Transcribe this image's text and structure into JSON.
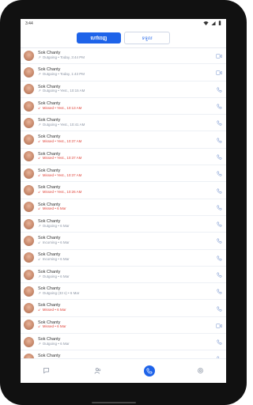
{
  "status": {
    "time": "3:44"
  },
  "tabs": [
    {
      "label": "ហៅចេញ",
      "active": true
    },
    {
      "label": "ទទួល",
      "active": false
    }
  ],
  "calls": [
    {
      "name": "Sok Chanty",
      "detail": "Outgoing • Today, 3:44 PM",
      "type": "outgoing",
      "icon": "video-icon"
    },
    {
      "name": "Sok Chanty",
      "detail": "Outgoing • Today, 1:43 PM",
      "type": "outgoing",
      "icon": "video-icon"
    },
    {
      "name": "Sok Chanty",
      "detail": "Outgoing • Yest., 10:15 AM",
      "type": "outgoing",
      "icon": "phone-icon"
    },
    {
      "name": "Sok Chanty",
      "detail": "Missed • Yest., 10:13 AM",
      "type": "missed",
      "icon": "phone-icon"
    },
    {
      "name": "Sok Chanty",
      "detail": "Outgoing • Yest., 10:41 AM",
      "type": "outgoing",
      "icon": "phone-icon"
    },
    {
      "name": "Sok Chanty",
      "detail": "Missed • Yest., 10:37 AM",
      "type": "missed",
      "icon": "phone-icon"
    },
    {
      "name": "Sok Chanty",
      "detail": "Missed • Yest., 10:37 AM",
      "type": "missed",
      "icon": "phone-icon"
    },
    {
      "name": "Sok Chanty",
      "detail": "Missed • Yest., 10:37 AM",
      "type": "missed",
      "icon": "phone-icon"
    },
    {
      "name": "Sok Chanty",
      "detail": "Missed • Yest., 10:26 AM",
      "type": "missed",
      "icon": "phone-icon"
    },
    {
      "name": "Sok Chanty",
      "detail": "Missed • 6 Mar",
      "type": "missed",
      "icon": "phone-icon"
    },
    {
      "name": "Sok Chanty",
      "detail": "Outgoing • 6 Mar",
      "type": "outgoing",
      "icon": "phone-icon"
    },
    {
      "name": "Sok Chanty",
      "detail": "Incoming • 6 Mar",
      "type": "incoming",
      "icon": "phone-icon"
    },
    {
      "name": "Sok Chanty",
      "detail": "Incoming • 6 Mar",
      "type": "incoming",
      "icon": "phone-icon"
    },
    {
      "name": "Sok Chanty",
      "detail": "Outgoing • 6 Mar",
      "type": "outgoing",
      "icon": "phone-icon"
    },
    {
      "name": "Sok Chanty",
      "detail": "Outgoing (33 s) • 6 Mar",
      "type": "outgoing",
      "icon": "phone-icon"
    },
    {
      "name": "Sok Chanty",
      "detail": "Missed • 6 Mar",
      "type": "missed",
      "icon": "phone-icon"
    },
    {
      "name": "Sok Chanty",
      "detail": "Missed • 6 Mar",
      "type": "missed",
      "icon": "video-icon"
    },
    {
      "name": "Sok Chanty",
      "detail": "Outgoing • 6 Mar",
      "type": "outgoing",
      "icon": "phone-icon"
    },
    {
      "name": "Sok Chanty",
      "detail": "Missed • 6 Mar",
      "type": "missed",
      "icon": "phone-icon"
    }
  ],
  "nav": [
    {
      "icon": "chat-icon",
      "active": false
    },
    {
      "icon": "contacts-icon",
      "active": false
    },
    {
      "icon": "phone-icon",
      "active": true
    },
    {
      "icon": "settings-icon",
      "active": false
    }
  ],
  "colors": {
    "accent": "#1e63e9",
    "missed": "#e0463c",
    "muted": "#8a93a3"
  }
}
